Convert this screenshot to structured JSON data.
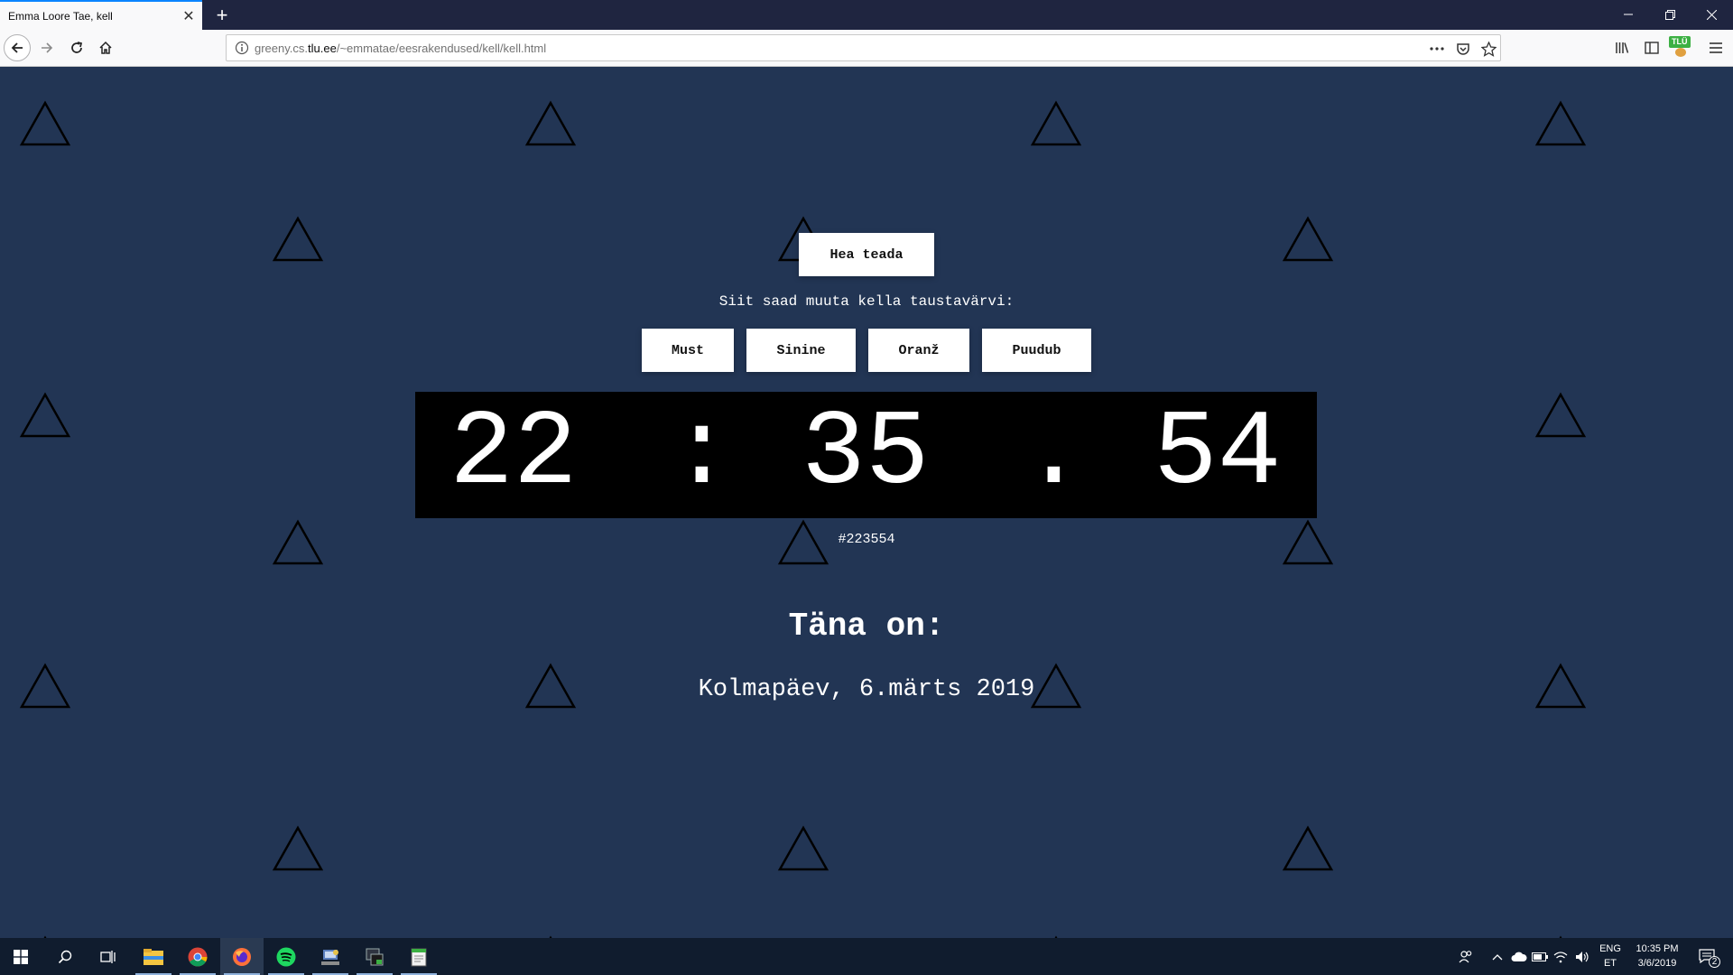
{
  "browser": {
    "tab_title": "Emma Loore Tae, kell",
    "url_prefix": "greeny.cs.",
    "url_domain": "tlu.ee",
    "url_path": "/~emmatae/eesrakendused/kell/kell.html",
    "extension_badge": "TLÜ"
  },
  "page": {
    "info_button": "Hea teada",
    "instruction": "Siit saad muuta kella taustavärvi:",
    "color_buttons": [
      "Must",
      "Sinine",
      "Oranž",
      "Puudub"
    ],
    "clock": {
      "hours": "22",
      "sep1": ":",
      "minutes": "35",
      "sep2": ".",
      "seconds": "54"
    },
    "hex_color": "#223554",
    "today_label": "Täna on:",
    "date": "Kolmapäev, 6.märts 2019",
    "background_color": "#223554"
  },
  "taskbar": {
    "lang_line1": "ENG",
    "lang_line2": "ET",
    "time": "10:35 PM",
    "date": "3/6/2019",
    "notification_count": "2",
    "apps": [
      "file-explorer",
      "chrome",
      "firefox",
      "spotify",
      "network-app",
      "terminal-app",
      "notepad-app"
    ]
  }
}
